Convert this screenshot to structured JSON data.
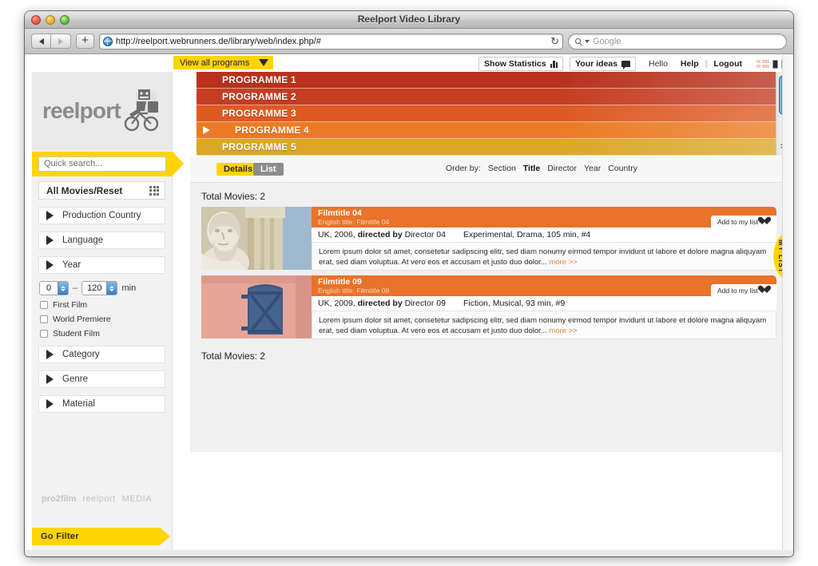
{
  "window": {
    "title": "Reelport Video Library",
    "traffic_lights": [
      "close-red",
      "minimize-yellow",
      "zoom-green"
    ]
  },
  "browser": {
    "back_icon": "back-arrow-icon",
    "forward_icon": "forward-arrow-icon",
    "add_tab_label": "+",
    "url": "http://reelport.webrunners.de/library/web/index.php/#",
    "reload_icon": "reload-icon",
    "search_placeholder": "Google"
  },
  "topbar": {
    "view_all_label": "View all programs",
    "view_all_caret": "caret-down-icon",
    "show_statistics": "Show Statistics",
    "your_ideas": "Your ideas",
    "hello": "Hello",
    "help": "Help",
    "separator": "|",
    "logout": "Logout",
    "flags": [
      "flag-denmark-icon",
      "flag-mono-1-icon",
      "flag-mono-2-icon"
    ]
  },
  "sidebar": {
    "logo_text": "reelport",
    "logo_icon": "delivery-cyclist-icon",
    "quick_search_placeholder": "Quick search...",
    "quick_search_value": "",
    "all_movies_label": "All Movies/Reset",
    "grid_icon": "grid-icon",
    "filters": [
      {
        "label": "Production Country",
        "icon": "triangle-right-icon"
      },
      {
        "label": "Language",
        "icon": "triangle-right-icon"
      },
      {
        "label": "Year",
        "icon": "triangle-right-icon"
      }
    ],
    "duration": {
      "min_value": "0",
      "max_value": "120",
      "dash": "–",
      "unit": "min"
    },
    "checkboxes": [
      {
        "label": "First Film",
        "checked": false
      },
      {
        "label": "World Premiere",
        "checked": false
      },
      {
        "label": "Student Film",
        "checked": false
      }
    ],
    "filters2": [
      {
        "label": "Category",
        "icon": "triangle-right-icon"
      },
      {
        "label": "Genre",
        "icon": "triangle-right-icon"
      },
      {
        "label": "Material",
        "icon": "triangle-right-icon"
      }
    ],
    "footer_logos": [
      "pro2film",
      "reelport",
      "MEDIA"
    ],
    "go_filter_label": "Go Filter"
  },
  "programmes": [
    {
      "label": "PROGRAMME 1",
      "color": "#b8321c",
      "selected": false
    },
    {
      "label": "PROGRAMME 2",
      "color": "#c53d22",
      "selected": false
    },
    {
      "label": "PROGRAMME 3",
      "color": "#dd5a22",
      "selected": false
    },
    {
      "label": "PROGRAMME 4",
      "color": "#ea7b24",
      "selected": true
    },
    {
      "label": "PROGRAMME 5",
      "color": "#dba728",
      "selected": false
    }
  ],
  "main": {
    "tabs": [
      {
        "label": "Details",
        "active": true
      },
      {
        "label": "List",
        "active": false
      }
    ],
    "order_by_label": "Order by:",
    "order_by_options": [
      {
        "label": "Section",
        "selected": false
      },
      {
        "label": "Title",
        "selected": true
      },
      {
        "label": "Director",
        "selected": false
      },
      {
        "label": "Year",
        "selected": false
      },
      {
        "label": "Country",
        "selected": false
      }
    ],
    "total_top": "Total Movies: 2",
    "total_bottom": "Total Movies: 2",
    "add_to_list_label": "Add to my list",
    "heart_icon": "heart-icon",
    "more_label": "more >>",
    "movies": [
      {
        "title": "Filmtitle 04",
        "english_title": "English title: Filmtitle 04",
        "country": "UK",
        "year": "2006",
        "directed_by": "directed by",
        "director": "Director 04",
        "genres": "Experimental, Drama, 105 min, #4",
        "description": "Lorem ipsum dolor sit amet, consetetur sadipscing elitr, sed diam nonumy eirmod tempor invidunt ut labore et dolore magna aliquyam erat, sed diam voluptua. At vero eos et accusam et justo duo dolor...",
        "thumbnail": "marble-bust-statue-photo"
      },
      {
        "title": "Filmtitle 09",
        "english_title": "English title: Filmtitle 09",
        "country": "UK",
        "year": "2009",
        "directed_by": "directed by",
        "director": "Director 09",
        "genres": "Fiction, Musical, 93 min, #9",
        "description": "Lorem ipsum dolor sit amet, consetetur sadipscing elitr, sed diam nonumy eirmod tempor invidunt ut labore et dolore magna aliquyam erat, sed diam voluptua. At vero eos et accusam et justo duo dolor...",
        "thumbnail": "blue-shutter-pink-wall-photo"
      }
    ]
  },
  "mylist": {
    "label": "MY LIST"
  },
  "colors": {
    "accent_yellow": "#ffd400",
    "movie_header_orange": "#e8732a",
    "programme_start": "#b8321c",
    "programme_end": "#dba728"
  }
}
